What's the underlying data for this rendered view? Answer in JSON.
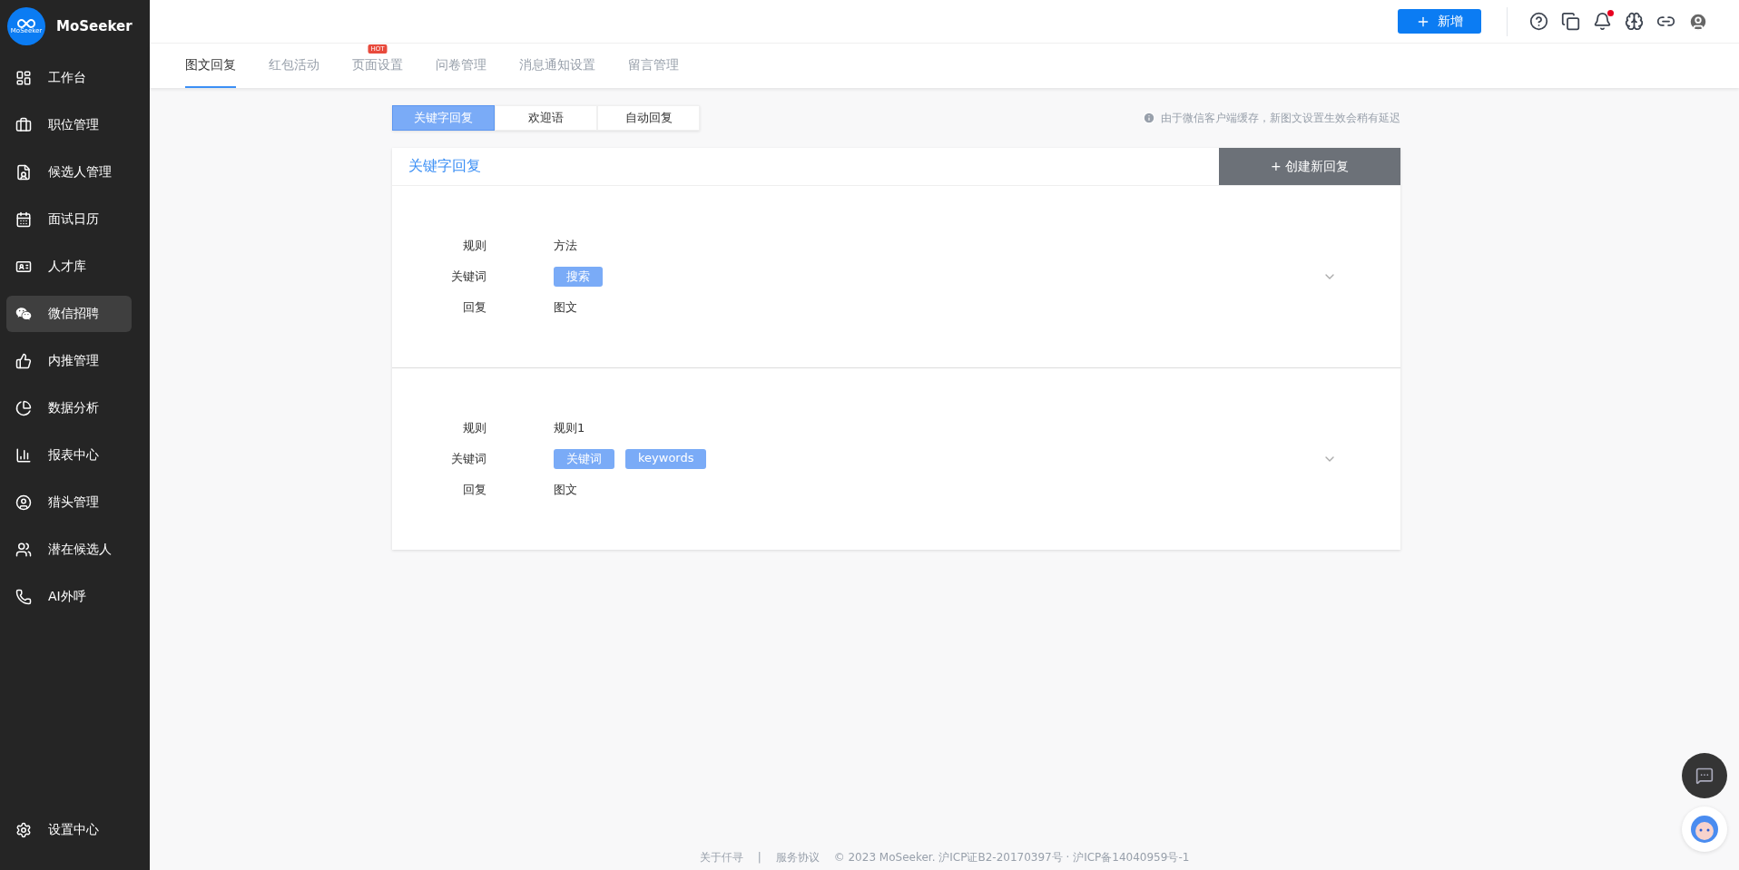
{
  "sidebar": {
    "logo_caption": "MoSeeker",
    "brand": "MoSeeker",
    "items": [
      {
        "label": "工作台",
        "selected": false
      },
      {
        "label": "职位管理",
        "selected": false
      },
      {
        "label": "候选人管理",
        "selected": false
      },
      {
        "label": "面试日历",
        "selected": false
      },
      {
        "label": "人才库",
        "selected": false
      },
      {
        "label": "微信招聘",
        "selected": true
      },
      {
        "label": "内推管理",
        "selected": false
      },
      {
        "label": "数据分析",
        "selected": false
      },
      {
        "label": "报表中心",
        "selected": false
      },
      {
        "label": "猎头管理",
        "selected": false
      },
      {
        "label": "潜在候选人",
        "selected": false
      },
      {
        "label": "AI外呼",
        "selected": false
      }
    ],
    "settings": {
      "label": "设置中心"
    }
  },
  "header": {
    "new_button": "新增",
    "unread_notifications": true
  },
  "tabs": [
    {
      "label": "图文回复",
      "selected": true
    },
    {
      "label": "红包活动",
      "selected": false
    },
    {
      "label": "页面设置",
      "selected": false,
      "badge": "HOT"
    },
    {
      "label": "问卷管理",
      "selected": false
    },
    {
      "label": "消息通知设置",
      "selected": false
    },
    {
      "label": "留言管理",
      "selected": false
    }
  ],
  "segments": [
    {
      "label": "关键字回复",
      "selected": true
    },
    {
      "label": "欢迎语",
      "selected": false
    },
    {
      "label": "自动回复",
      "selected": false
    }
  ],
  "notice": "由于微信客户端缓存，新图文设置生效会稍有延迟",
  "panel": {
    "title": "关键字回复",
    "create_button": "+ 创建新回复",
    "rules": [
      {
        "expanded": false,
        "rows": [
          {
            "kind": "text",
            "label": "规则",
            "value": "方法"
          },
          {
            "kind": "tags",
            "label": "关键词",
            "tags": [
              "搜索"
            ]
          },
          {
            "kind": "text",
            "label": "回复",
            "value": "图文"
          }
        ]
      },
      {
        "expanded": false,
        "rows": [
          {
            "kind": "text",
            "label": "规则",
            "value": "规则1"
          },
          {
            "kind": "tags",
            "label": "关键词",
            "tags": [
              "关键词",
              "keywords"
            ]
          },
          {
            "kind": "text",
            "label": "回复",
            "value": "图文"
          }
        ]
      }
    ]
  },
  "footer": {
    "links": [
      "关于仟寻",
      "服务协议"
    ],
    "separator": "|",
    "copyright": "© 2023 MoSeeker. 沪ICP证B2-20170397号 · 沪ICP备14040959号-1"
  }
}
